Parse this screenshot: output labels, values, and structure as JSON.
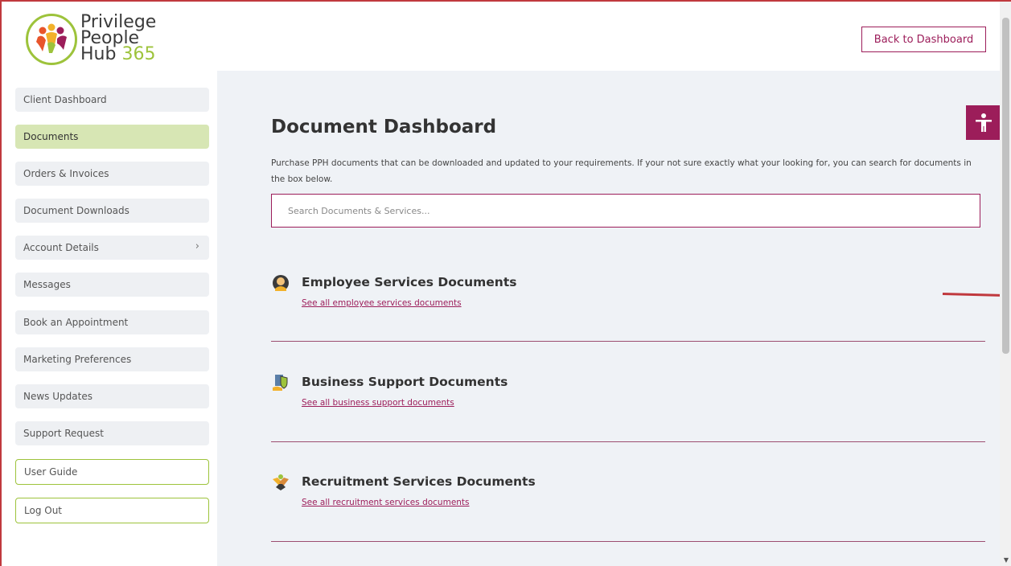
{
  "header": {
    "logo": {
      "line1": "Privilege",
      "line2": "People",
      "line3": "Hub",
      "line3_number": "365"
    },
    "back_button": "Back to Dashboard"
  },
  "sidebar": {
    "items": [
      {
        "label": "Client Dashboard"
      },
      {
        "label": "Documents"
      },
      {
        "label": "Orders & Invoices"
      },
      {
        "label": "Document Downloads"
      },
      {
        "label": "Account Details"
      },
      {
        "label": "Messages"
      },
      {
        "label": "Book an Appointment"
      },
      {
        "label": "Marketing Preferences"
      },
      {
        "label": "News Updates"
      },
      {
        "label": "Support Request"
      },
      {
        "label": "User Guide"
      },
      {
        "label": "Log Out"
      }
    ],
    "account_details_chevron": "›"
  },
  "main": {
    "title": "Document Dashboard",
    "intro": "Purchase PPH documents that can be downloaded and updated to your requirements. If your not sure exactly what your looking for, you can search for documents in the box below.",
    "search": {
      "placeholder": "Search Documents & Services..."
    },
    "sections": [
      {
        "title": "Employee Services Documents",
        "link": "See all employee services documents",
        "icon": "employee-services-icon"
      },
      {
        "title": "Business Support Documents",
        "link": "See all business support documents",
        "icon": "business-support-icon"
      },
      {
        "title": "Recruitment Services Documents",
        "link": "See all recruitment services documents",
        "icon": "recruitment-services-icon"
      }
    ]
  },
  "colors": {
    "brand": "#9c1d5a",
    "accent_green": "#9dc33b",
    "active_nav": "#d7e6b4",
    "main_bg": "#eff2f6"
  },
  "scrollbar": {
    "down_arrow": "▼"
  }
}
